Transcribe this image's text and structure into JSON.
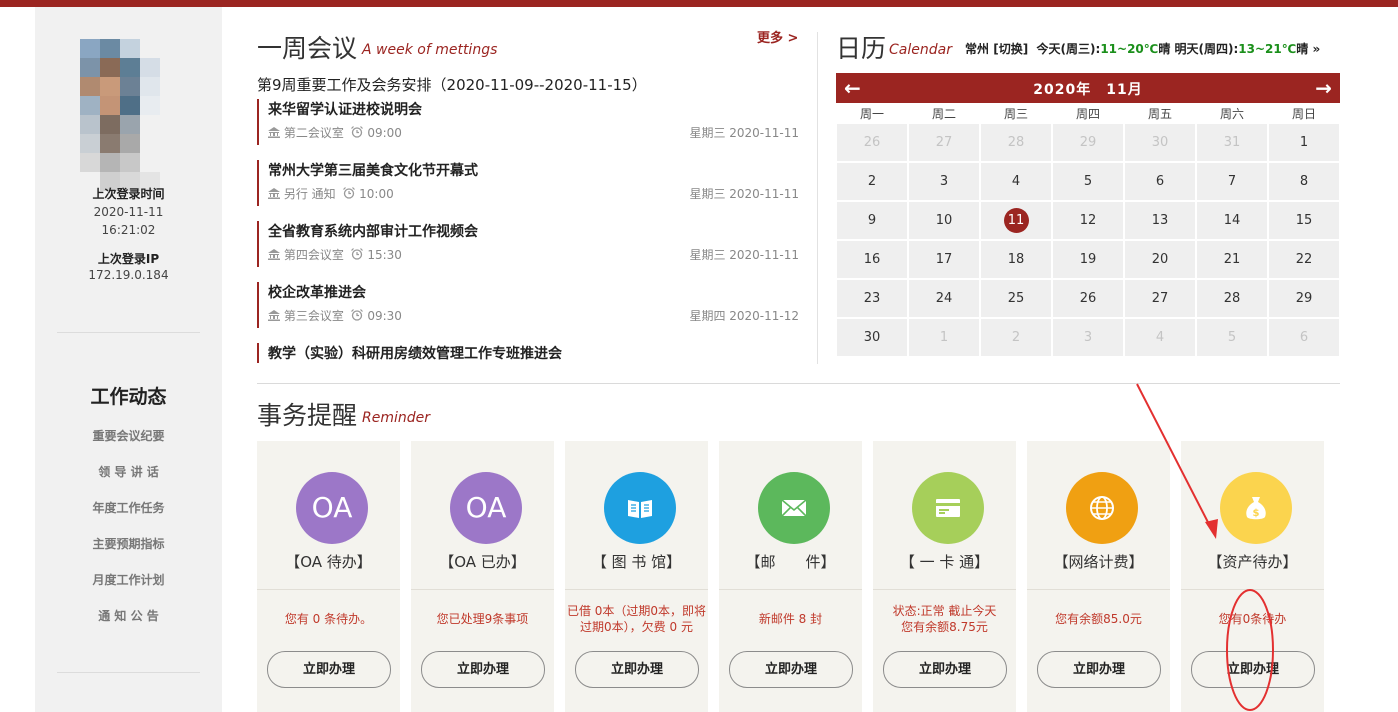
{
  "sidebar": {
    "last_login_label": "上次登录时间",
    "last_login_date": "2020-11-11",
    "last_login_time": "16:21:02",
    "last_ip_label": "上次登录IP",
    "last_ip": "172.19.0.184",
    "section_title": "工作动态",
    "links": [
      "重要会议纪要",
      "领 导 讲 话",
      "年度工作任务",
      "主要预期指标",
      "月度工作计划",
      "通 知 公 告"
    ]
  },
  "meetings": {
    "title": "一周会议",
    "subtitle": "A week of mettings",
    "more": "更多 >",
    "week_heading": "第9周重要工作及会务安排（2020-11-09--2020-11-15）",
    "items": [
      {
        "title": "来华留学认证进校说明会",
        "place": "第二会议室",
        "time": "09:00",
        "date": "星期三 2020-11-11"
      },
      {
        "title": "常州大学第三届美食文化节开幕式",
        "place": "另行 通知",
        "time": "10:00",
        "date": "星期三 2020-11-11"
      },
      {
        "title": "全省教育系统内部审计工作视频会",
        "place": "第四会议室",
        "time": "15:30",
        "date": "星期三 2020-11-11"
      },
      {
        "title": "校企改革推进会",
        "place": "第三会议室",
        "time": "09:30",
        "date": "星期四 2020-11-12"
      },
      {
        "title": "教学（实验）科研用房绩效管理工作专班推进会",
        "place": "",
        "time": "",
        "date": ""
      }
    ]
  },
  "calendar": {
    "title": "日历",
    "subtitle": "Calendar",
    "weather": {
      "city": "常州",
      "switch": "[切换]",
      "today_label": "今天(周三):",
      "today_temp": "11~20℃",
      "today_cond": "晴",
      "tomorrow_label": "明天(周四):",
      "tomorrow_temp": "13~21℃",
      "tomorrow_cond": "晴",
      "next": "»"
    },
    "prev": "←",
    "next": "→",
    "month_label": "2020年　11月",
    "weekdays": [
      "周一",
      "周二",
      "周三",
      "周四",
      "周五",
      "周六",
      "周日"
    ],
    "days": [
      [
        "26",
        "27",
        "28",
        "29",
        "30",
        "31",
        "1"
      ],
      [
        "2",
        "3",
        "4",
        "5",
        "6",
        "7",
        "8"
      ],
      [
        "9",
        "10",
        "11",
        "12",
        "13",
        "14",
        "15"
      ],
      [
        "16",
        "17",
        "18",
        "19",
        "20",
        "21",
        "22"
      ],
      [
        "23",
        "24",
        "25",
        "26",
        "27",
        "28",
        "29"
      ],
      [
        "30",
        "1",
        "2",
        "3",
        "4",
        "5",
        "6"
      ]
    ],
    "today": "11",
    "accent": "#9b2521"
  },
  "reminder": {
    "title": "事务提醒",
    "subtitle": "Reminder",
    "cards": [
      {
        "icon": "oa-icon",
        "icon_text": "OA",
        "color": "#9c77c8",
        "label": "【OA 待办】",
        "status": [
          "您有 0 条待办。"
        ],
        "button": "立即办理"
      },
      {
        "icon": "oa-done-icon",
        "icon_text": "OA",
        "color": "#9c77c8",
        "label": "【OA 已办】",
        "status": [
          "您已处理9条事项"
        ],
        "button": "立即办理"
      },
      {
        "icon": "book-icon",
        "icon_text": "",
        "color": "#1ea0e0",
        "label": "【 图 书 馆】",
        "status": [
          "已借 0本（过期0本，即将",
          "过期0本），欠费 0 元"
        ],
        "button": "立即办理"
      },
      {
        "icon": "mail-icon",
        "icon_text": "",
        "color": "#5cb85c",
        "label": "【邮　　件】",
        "status": [
          "新邮件 8 封"
        ],
        "button": "立即办理"
      },
      {
        "icon": "card-icon",
        "icon_text": "",
        "color": "#a6cf5a",
        "label": "【 一 卡 通】",
        "status": [
          "状态:正常  截止今天",
          "您有余额8.75元"
        ],
        "button": "立即办理"
      },
      {
        "icon": "globe-icon",
        "icon_text": "",
        "color": "#f0a012",
        "label": "【网络计费】",
        "status": [
          "您有余额85.0元"
        ],
        "button": "立即办理"
      },
      {
        "icon": "money-bag-icon",
        "icon_text": "",
        "color": "#fbd44e",
        "label": "【资产待办】",
        "status": [
          "您有0条待办"
        ],
        "button": "立即办理"
      }
    ]
  }
}
